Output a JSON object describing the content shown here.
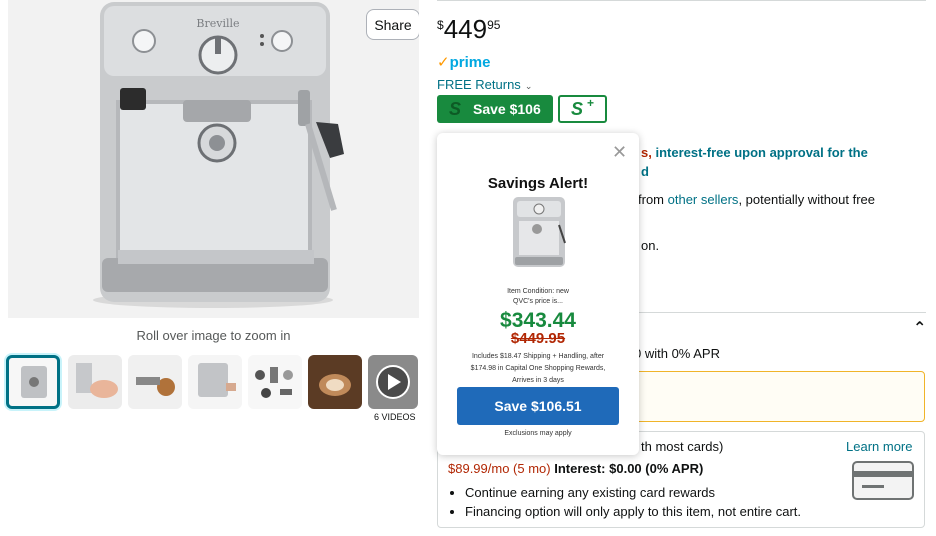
{
  "product": {
    "share_label": "Share",
    "zoom_hint": "Roll over image to zoom in",
    "brand_text": "Breville",
    "videos_label": "6 VIDEOS"
  },
  "buybox": {
    "price_symbol": "$",
    "price_whole": "449",
    "price_fraction": "95",
    "prime_label": "prime",
    "free_returns": "FREE Returns",
    "save_button": "Save $106",
    "s_plus": "S",
    "s_plus_sup": "+"
  },
  "background_text": {
    "interest_prefix": "s,",
    "interest_line1": " interest-free upon approval for the",
    "interest_line2": "d",
    "sellers_prefix": "from ",
    "sellers_link": "other sellers",
    "sellers_suffix": ", potentially without free",
    "on_text": "on.",
    "apr_text": "0 with 0% APR",
    "most_cards": "th most cards)",
    "learn_more": "Learn more",
    "payment_amount": "$89.99/mo (5 mo)",
    "interest_label": " Interest: $0.00 (0% APR)",
    "bullets": [
      "Continue earning any existing card rewards",
      "Financing option will only apply to this item, not entire cart."
    ]
  },
  "popup": {
    "close": "✕",
    "title": "Savings Alert!",
    "condition": "Item Condition: new",
    "qvc_line": "QVC's price is...",
    "new_price": "$343.44",
    "old_price": "$449.95",
    "includes_line1": "Includes $18.47 Shipping + Handling, after",
    "includes_line2": "$174.98 in Capital One Shopping Rewards,",
    "includes_line3": "Arrives in 3 days",
    "cta": "Save $106.51",
    "exclusions": "Exclusions may apply"
  },
  "colors": {
    "accent_green": "#188a3e",
    "link_teal": "#007185",
    "price_red": "#b12704",
    "cta_blue": "#1f6ab9",
    "prime_blue": "#00a8e1"
  }
}
